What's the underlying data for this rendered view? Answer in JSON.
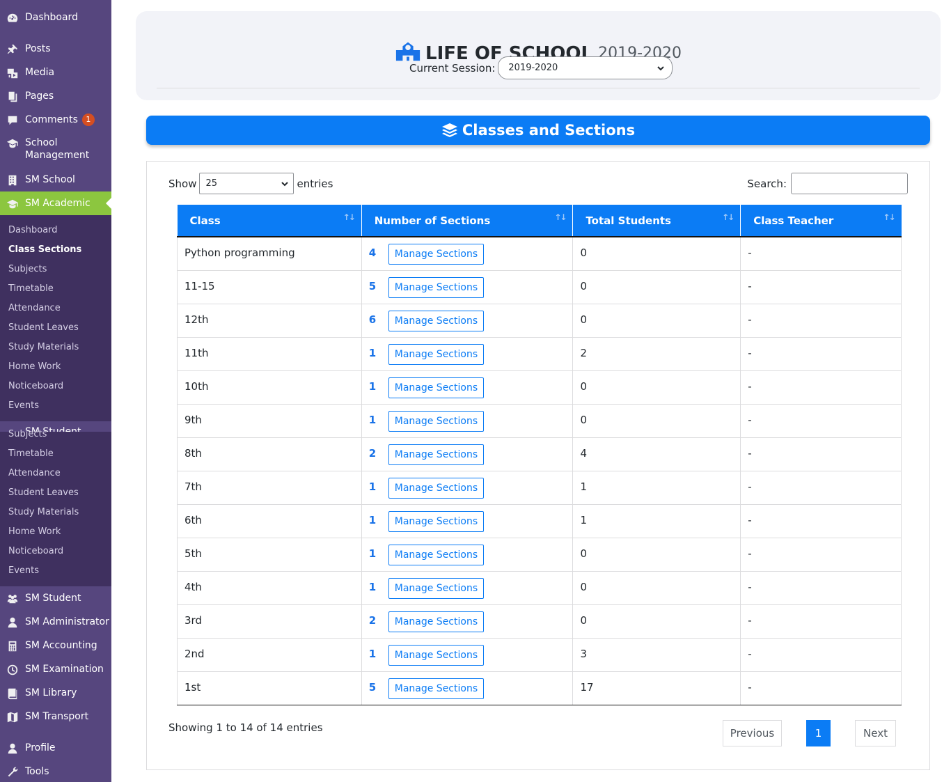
{
  "sidebar": {
    "top_items": [
      {
        "label": "Dashboard",
        "icon": "dashboard-icon"
      },
      {
        "label": "Posts",
        "icon": "pin-icon"
      },
      {
        "label": "Media",
        "icon": "media-icon"
      },
      {
        "label": "Pages",
        "icon": "pages-icon"
      },
      {
        "label": "Comments",
        "icon": "comment-icon",
        "badge": "1"
      },
      {
        "label": "School Management",
        "icon": "graduation-cap-icon"
      },
      {
        "label": "SM School",
        "icon": "building-icon"
      },
      {
        "label": "SM Academic",
        "icon": "graduation-cap-icon"
      }
    ],
    "academic_sub": [
      "Dashboard",
      "Class Sections",
      "Subjects",
      "Timetable",
      "Attendance",
      "Student Leaves",
      "Study Materials",
      "Home Work",
      "Noticeboard",
      "Events"
    ],
    "flyout_overlap_label": "SM Student",
    "student_sub": [
      "Subjects",
      "Timetable",
      "Attendance",
      "Student Leaves",
      "Study Materials",
      "Home Work",
      "Noticeboard",
      "Events"
    ],
    "bottom_items": [
      {
        "label": "SM Student",
        "icon": "users-icon"
      },
      {
        "label": "SM Administrator",
        "icon": "user-icon"
      },
      {
        "label": "SM Accounting",
        "icon": "calculator-icon"
      },
      {
        "label": "SM Examination",
        "icon": "clock-icon"
      },
      {
        "label": "SM Library",
        "icon": "book-icon"
      },
      {
        "label": "SM Transport",
        "icon": "map-icon"
      },
      {
        "label": "Profile",
        "icon": "user-icon"
      },
      {
        "label": "Tools",
        "icon": "wrench-icon"
      }
    ]
  },
  "header": {
    "school_name": "LIFE OF SCHOOL",
    "session_year": "2019-2020",
    "session_label": "Current Session:",
    "session_value": "2019-2020"
  },
  "section_title": "Classes and Sections",
  "table_controls": {
    "show_label": "Show",
    "length_value": "25",
    "entries_label": "entries",
    "search_label": "Search:"
  },
  "table": {
    "columns": [
      "Class",
      "Number of Sections",
      "Total Students",
      "Class Teacher"
    ],
    "manage_label": "Manage Sections",
    "rows": [
      {
        "class": "Python programming",
        "sections": "4",
        "students": "0",
        "teacher": "-"
      },
      {
        "class": "11-15",
        "sections": "5",
        "students": "0",
        "teacher": "-"
      },
      {
        "class": "12th",
        "sections": "6",
        "students": "0",
        "teacher": "-"
      },
      {
        "class": "11th",
        "sections": "1",
        "students": "2",
        "teacher": "-"
      },
      {
        "class": "10th",
        "sections": "1",
        "students": "0",
        "teacher": "-"
      },
      {
        "class": "9th",
        "sections": "1",
        "students": "0",
        "teacher": "-"
      },
      {
        "class": "8th",
        "sections": "2",
        "students": "4",
        "teacher": "-"
      },
      {
        "class": "7th",
        "sections": "1",
        "students": "1",
        "teacher": "-"
      },
      {
        "class": "6th",
        "sections": "1",
        "students": "1",
        "teacher": "-"
      },
      {
        "class": "5th",
        "sections": "1",
        "students": "0",
        "teacher": "-"
      },
      {
        "class": "4th",
        "sections": "1",
        "students": "0",
        "teacher": "-"
      },
      {
        "class": "3rd",
        "sections": "2",
        "students": "0",
        "teacher": "-"
      },
      {
        "class": "2nd",
        "sections": "1",
        "students": "3",
        "teacher": "-"
      },
      {
        "class": "1st",
        "sections": "5",
        "students": "17",
        "teacher": "-"
      }
    ]
  },
  "footer": {
    "info": "Showing 1 to 14 of 14 entries",
    "previous": "Previous",
    "page": "1",
    "next": "Next"
  },
  "colors": {
    "sidebar": "#56467e",
    "active_menu": "#8cc63f",
    "primary": "#0b7cf5"
  }
}
